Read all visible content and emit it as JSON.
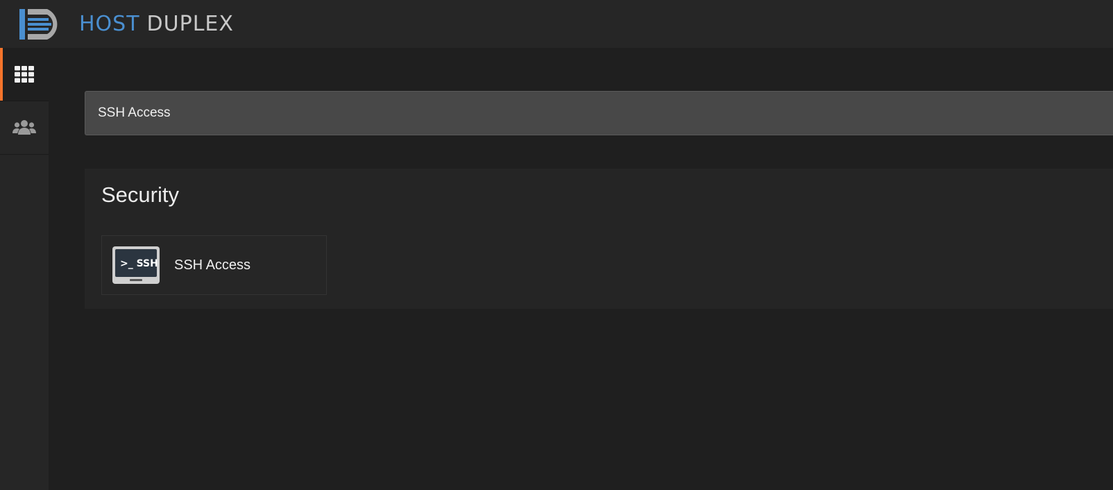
{
  "header": {
    "brand_host": "HOST",
    "brand_duplex": "DUPLEX"
  },
  "sidebar": {
    "items": [
      {
        "icon": "grid-icon",
        "active": true
      },
      {
        "icon": "users-icon",
        "active": false
      }
    ]
  },
  "search": {
    "value": "SSH Access"
  },
  "section": {
    "title": "Security",
    "tools": [
      {
        "label": "SSH Access",
        "icon": "ssh-terminal-icon",
        "icon_text": ">_ SSH"
      }
    ]
  },
  "colors": {
    "accent": "#f4742b",
    "brand_blue": "#4a8fd0",
    "brand_gray": "#c8c8c8"
  }
}
